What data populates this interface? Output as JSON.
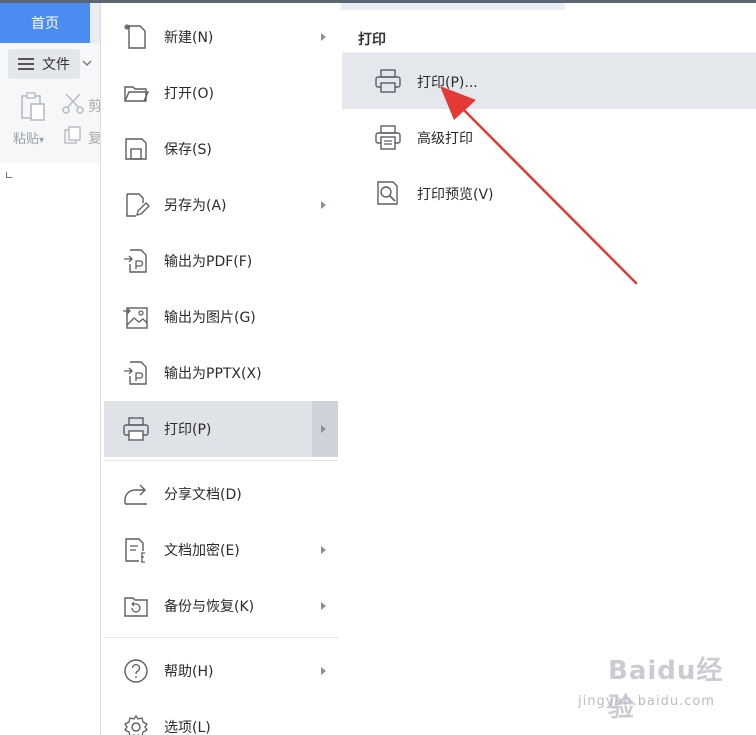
{
  "header": {
    "home_tab": "首页"
  },
  "ribbon": {
    "file_button": "文件",
    "paste_label": "粘贴",
    "paste_dropdown": "▾",
    "cut_label": "剪",
    "copy_label": "复"
  },
  "menu": {
    "items": [
      {
        "label": "新建(N)",
        "icon": "new-file-icon",
        "has_submenu": true
      },
      {
        "label": "打开(O)",
        "icon": "folder-open-icon",
        "has_submenu": false
      },
      {
        "label": "保存(S)",
        "icon": "save-icon",
        "has_submenu": false
      },
      {
        "label": "另存为(A)",
        "icon": "save-as-icon",
        "has_submenu": true
      },
      {
        "label": "输出为PDF(F)",
        "icon": "export-pdf-icon",
        "has_submenu": false
      },
      {
        "label": "输出为图片(G)",
        "icon": "export-image-icon",
        "has_submenu": false
      },
      {
        "label": "输出为PPTX(X)",
        "icon": "export-pptx-icon",
        "has_submenu": false
      },
      {
        "label": "打印(P)",
        "icon": "printer-icon",
        "has_submenu": true,
        "active": true
      },
      {
        "label": "分享文档(D)",
        "icon": "share-icon",
        "has_submenu": false
      },
      {
        "label": "文档加密(E)",
        "icon": "encrypt-document-icon",
        "has_submenu": true
      },
      {
        "label": "备份与恢复(K)",
        "icon": "backup-restore-icon",
        "has_submenu": true
      },
      {
        "label": "帮助(H)",
        "icon": "help-icon",
        "has_submenu": true
      },
      {
        "label": "选项(L)",
        "icon": "gear-icon",
        "has_submenu": false
      }
    ]
  },
  "submenu": {
    "title": "打印",
    "items": [
      {
        "label": "打印(P)...",
        "icon": "printer-icon",
        "hover": true
      },
      {
        "label": "高级打印",
        "icon": "advanced-print-icon"
      },
      {
        "label": "打印预览(V)",
        "icon": "print-preview-icon"
      }
    ]
  },
  "watermark": {
    "brand": "Baidu经验",
    "url": "jingyan.baidu.com"
  },
  "colors": {
    "accent_tab": "#4b8cf2",
    "annotation_arrow": "#e53935",
    "active_row": "#dfe2e7"
  }
}
